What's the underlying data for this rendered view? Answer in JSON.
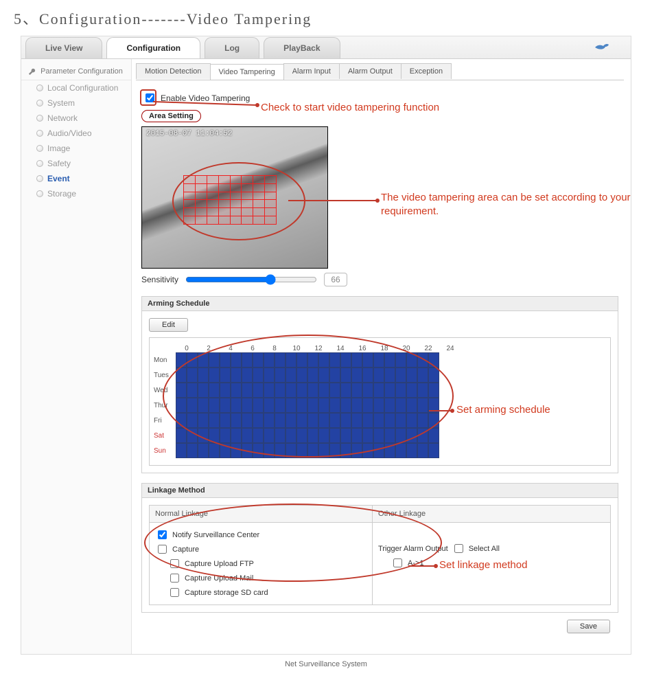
{
  "doc_heading": "5、Configuration-------Video  Tampering",
  "top_tabs": [
    "Live View",
    "Configuration",
    "Log",
    "PlayBack"
  ],
  "top_active": 1,
  "sidebar": {
    "title": "Parameter Configuration",
    "items": [
      "Local Configuration",
      "System",
      "Network",
      "Audio/Video",
      "Image",
      "Safety",
      "Event",
      "Storage"
    ],
    "active": 6
  },
  "sub_tabs": [
    "Motion Detection",
    "Video Tampering",
    "Alarm Input",
    "Alarm Output",
    "Exception"
  ],
  "sub_active": 1,
  "enable_label": "Enable Video Tampering",
  "enable_checked": true,
  "area_setting_label": "Area Setting",
  "video_timestamp": "2015-08-07 11:04:52",
  "sensitivity_label": "Sensitivity",
  "sensitivity_value": "66",
  "arming_schedule_label": "Arming Schedule",
  "edit_label": "Edit",
  "hours": [
    "0",
    "2",
    "4",
    "6",
    "8",
    "10",
    "12",
    "14",
    "16",
    "18",
    "20",
    "22",
    "24"
  ],
  "days": [
    {
      "label": "Mon",
      "weekend": false
    },
    {
      "label": "Tues",
      "weekend": false
    },
    {
      "label": "Wed",
      "weekend": false
    },
    {
      "label": "Thur",
      "weekend": false
    },
    {
      "label": "Fri",
      "weekend": false
    },
    {
      "label": "Sat",
      "weekend": true
    },
    {
      "label": "Sun",
      "weekend": true
    }
  ],
  "linkage_label": "Linkage Method",
  "linkage_cols": [
    "Normal Linkage",
    "Other Linkage"
  ],
  "normal_linkage": [
    {
      "label": "Notify Surveillance Center",
      "checked": true,
      "sub": false
    },
    {
      "label": "Capture",
      "checked": false,
      "sub": false
    },
    {
      "label": "Capture Upload FTP",
      "checked": false,
      "sub": true
    },
    {
      "label": "Capture Upload Mail",
      "checked": false,
      "sub": true
    },
    {
      "label": "Capture storage SD card",
      "checked": false,
      "sub": true
    }
  ],
  "other_linkage": {
    "trigger_label": "Trigger Alarm Output",
    "select_all_label": "Select All",
    "select_all_checked": false,
    "options": [
      {
        "label": "A->1",
        "checked": false
      }
    ]
  },
  "save_label": "Save",
  "footer": "Net Surveillance System",
  "annotations": {
    "a1": "Check to start video tampering function",
    "a2": "The video tampering area can be set according to your requirement.",
    "a3": "Set arming schedule",
    "a4": "Set  linkage method"
  }
}
